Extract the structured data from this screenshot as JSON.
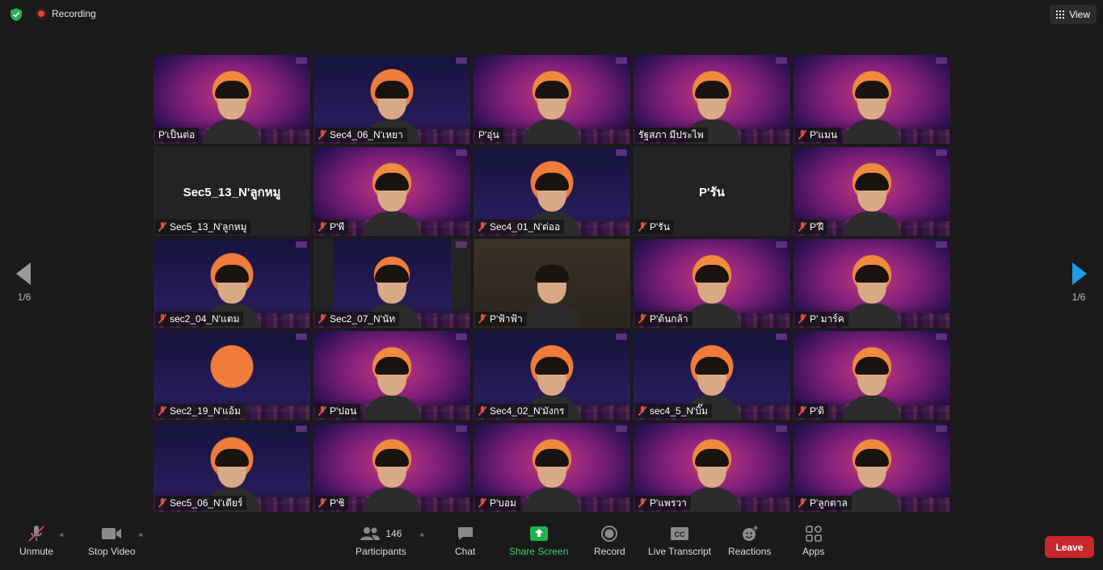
{
  "recording_label": "Recording",
  "view_label": "View",
  "page_indicator": "1/6",
  "tiles": [
    {
      "name": "P'เป็นต่อ",
      "muted": false,
      "style": "bg"
    },
    {
      "name": "Sec4_06_N'เหยา",
      "muted": true,
      "style": "night"
    },
    {
      "name": "P'อุ่น",
      "muted": false,
      "style": "bg",
      "active": true
    },
    {
      "name": "รัฐสภา มีประไพ",
      "muted": false,
      "style": "bg"
    },
    {
      "name": "P'แมน",
      "muted": true,
      "style": "bg"
    },
    {
      "name": "Sec5_13_N'ลูกหมู",
      "muted": true,
      "style": "none",
      "big": "Sec5_13_N'ลูกหมู"
    },
    {
      "name": "P'พี",
      "muted": true,
      "style": "bg"
    },
    {
      "name": "Sec4_01_N'ต่ออ",
      "muted": true,
      "style": "night"
    },
    {
      "name": "P'รัน",
      "muted": true,
      "style": "none",
      "big": "P'รัน"
    },
    {
      "name": "P'ฝี",
      "muted": true,
      "style": "bg"
    },
    {
      "name": "sec2_04_N'แตม",
      "muted": true,
      "style": "night"
    },
    {
      "name": "Sec2_07_N'นัท",
      "muted": true,
      "style": "narrow"
    },
    {
      "name": "P'ฟ้าฟ้า",
      "muted": true,
      "style": "plain"
    },
    {
      "name": "P'ต้นกล้า",
      "muted": true,
      "style": "bg"
    },
    {
      "name": "P' มาร์ค",
      "muted": true,
      "style": "bg"
    },
    {
      "name": "Sec2_19_N'แอ้ม",
      "muted": true,
      "style": "night"
    },
    {
      "name": "P'ปอน",
      "muted": true,
      "style": "bg"
    },
    {
      "name": "Sec4_02_N'มังกร",
      "muted": true,
      "style": "night"
    },
    {
      "name": "sec4_5_N'บิ๊ม",
      "muted": true,
      "style": "night"
    },
    {
      "name": "P'ดิ",
      "muted": true,
      "style": "bg"
    },
    {
      "name": "Sec5_06_N'เดียร์",
      "muted": true,
      "style": "night"
    },
    {
      "name": "P'ชิ",
      "muted": true,
      "style": "bg"
    },
    {
      "name": "P'บอม",
      "muted": true,
      "style": "bg"
    },
    {
      "name": "P'แพรวา",
      "muted": true,
      "style": "bg"
    },
    {
      "name": "P'ลูกตาล",
      "muted": true,
      "style": "bg"
    }
  ],
  "toolbar": {
    "unmute": "Unmute",
    "stop_video": "Stop Video",
    "participants": "Participants",
    "participants_count": "146",
    "chat": "Chat",
    "share_screen": "Share Screen",
    "record": "Record",
    "live_transcript": "Live Transcript",
    "reactions": "Reactions",
    "apps": "Apps",
    "leave": "Leave"
  },
  "colors": {
    "accent_green": "#3fcf6a",
    "leave_red": "#c8282c",
    "active_border": "#c8e36a"
  }
}
